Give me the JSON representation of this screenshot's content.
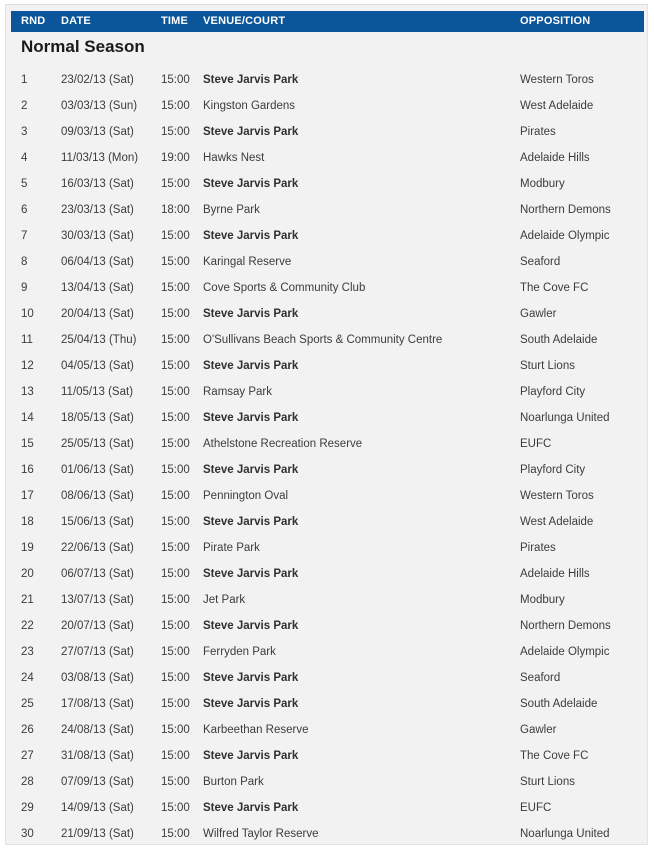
{
  "table": {
    "columns": {
      "rnd": "RND",
      "date": "DATE",
      "time": "TIME",
      "venue": "VENUE/COURT",
      "opposition": "OPPOSITION"
    },
    "section_title": "Normal Season",
    "header_color": "#0b559b",
    "panel_color": "#f2f2f2",
    "home_venue": "Steve Jarvis Park",
    "rows": [
      {
        "rnd": "1",
        "date": "23/02/13 (Sat)",
        "time": "15:00",
        "venue": "Steve Jarvis Park",
        "home": true,
        "opposition": "Western Toros"
      },
      {
        "rnd": "2",
        "date": "03/03/13 (Sun)",
        "time": "15:00",
        "venue": "Kingston Gardens",
        "home": false,
        "opposition": "West Adelaide"
      },
      {
        "rnd": "3",
        "date": "09/03/13 (Sat)",
        "time": "15:00",
        "venue": "Steve Jarvis Park",
        "home": true,
        "opposition": "Pirates"
      },
      {
        "rnd": "4",
        "date": "11/03/13 (Mon)",
        "time": "19:00",
        "venue": "Hawks Nest",
        "home": false,
        "opposition": "Adelaide Hills"
      },
      {
        "rnd": "5",
        "date": "16/03/13 (Sat)",
        "time": "15:00",
        "venue": "Steve Jarvis Park",
        "home": true,
        "opposition": "Modbury"
      },
      {
        "rnd": "6",
        "date": "23/03/13 (Sat)",
        "time": "18:00",
        "venue": "Byrne Park",
        "home": false,
        "opposition": "Northern Demons"
      },
      {
        "rnd": "7",
        "date": "30/03/13 (Sat)",
        "time": "15:00",
        "venue": "Steve Jarvis Park",
        "home": true,
        "opposition": "Adelaide Olympic"
      },
      {
        "rnd": "8",
        "date": "06/04/13 (Sat)",
        "time": "15:00",
        "venue": "Karingal Reserve",
        "home": false,
        "opposition": "Seaford"
      },
      {
        "rnd": "9",
        "date": "13/04/13 (Sat)",
        "time": "15:00",
        "venue": "Cove Sports & Community Club",
        "home": false,
        "opposition": "The Cove FC"
      },
      {
        "rnd": "10",
        "date": "20/04/13 (Sat)",
        "time": "15:00",
        "venue": "Steve Jarvis Park",
        "home": true,
        "opposition": "Gawler"
      },
      {
        "rnd": "11",
        "date": "25/04/13 (Thu)",
        "time": "15:00",
        "venue": "O'Sullivans Beach Sports & Community Centre",
        "home": false,
        "opposition": "South Adelaide"
      },
      {
        "rnd": "12",
        "date": "04/05/13 (Sat)",
        "time": "15:00",
        "venue": "Steve Jarvis Park",
        "home": true,
        "opposition": "Sturt Lions"
      },
      {
        "rnd": "13",
        "date": "11/05/13 (Sat)",
        "time": "15:00",
        "venue": "Ramsay Park",
        "home": false,
        "opposition": "Playford City"
      },
      {
        "rnd": "14",
        "date": "18/05/13 (Sat)",
        "time": "15:00",
        "venue": "Steve Jarvis Park",
        "home": true,
        "opposition": "Noarlunga United"
      },
      {
        "rnd": "15",
        "date": "25/05/13 (Sat)",
        "time": "15:00",
        "venue": "Athelstone Recreation Reserve",
        "home": false,
        "opposition": "EUFC"
      },
      {
        "rnd": "16",
        "date": "01/06/13 (Sat)",
        "time": "15:00",
        "venue": "Steve Jarvis Park",
        "home": true,
        "opposition": "Playford City"
      },
      {
        "rnd": "17",
        "date": "08/06/13 (Sat)",
        "time": "15:00",
        "venue": "Pennington Oval",
        "home": false,
        "opposition": "Western Toros"
      },
      {
        "rnd": "18",
        "date": "15/06/13 (Sat)",
        "time": "15:00",
        "venue": "Steve Jarvis Park",
        "home": true,
        "opposition": "West Adelaide"
      },
      {
        "rnd": "19",
        "date": "22/06/13 (Sat)",
        "time": "15:00",
        "venue": "Pirate Park",
        "home": false,
        "opposition": "Pirates"
      },
      {
        "rnd": "20",
        "date": "06/07/13 (Sat)",
        "time": "15:00",
        "venue": "Steve Jarvis Park",
        "home": true,
        "opposition": "Adelaide Hills"
      },
      {
        "rnd": "21",
        "date": "13/07/13 (Sat)",
        "time": "15:00",
        "venue": "Jet Park",
        "home": false,
        "opposition": "Modbury"
      },
      {
        "rnd": "22",
        "date": "20/07/13 (Sat)",
        "time": "15:00",
        "venue": "Steve Jarvis Park",
        "home": true,
        "opposition": "Northern Demons"
      },
      {
        "rnd": "23",
        "date": "27/07/13 (Sat)",
        "time": "15:00",
        "venue": "Ferryden Park",
        "home": false,
        "opposition": "Adelaide Olympic"
      },
      {
        "rnd": "24",
        "date": "03/08/13 (Sat)",
        "time": "15:00",
        "venue": "Steve Jarvis Park",
        "home": true,
        "opposition": "Seaford"
      },
      {
        "rnd": "25",
        "date": "17/08/13 (Sat)",
        "time": "15:00",
        "venue": "Steve Jarvis Park",
        "home": true,
        "opposition": "South Adelaide"
      },
      {
        "rnd": "26",
        "date": "24/08/13 (Sat)",
        "time": "15:00",
        "venue": "Karbeethan Reserve",
        "home": false,
        "opposition": "Gawler"
      },
      {
        "rnd": "27",
        "date": "31/08/13 (Sat)",
        "time": "15:00",
        "venue": "Steve Jarvis Park",
        "home": true,
        "opposition": "The Cove FC"
      },
      {
        "rnd": "28",
        "date": "07/09/13 (Sat)",
        "time": "15:00",
        "venue": "Burton Park",
        "home": false,
        "opposition": "Sturt Lions"
      },
      {
        "rnd": "29",
        "date": "14/09/13 (Sat)",
        "time": "15:00",
        "venue": "Steve Jarvis Park",
        "home": true,
        "opposition": "EUFC"
      },
      {
        "rnd": "30",
        "date": "21/09/13 (Sat)",
        "time": "15:00",
        "venue": "Wilfred Taylor Reserve",
        "home": false,
        "opposition": "Noarlunga United"
      }
    ]
  }
}
